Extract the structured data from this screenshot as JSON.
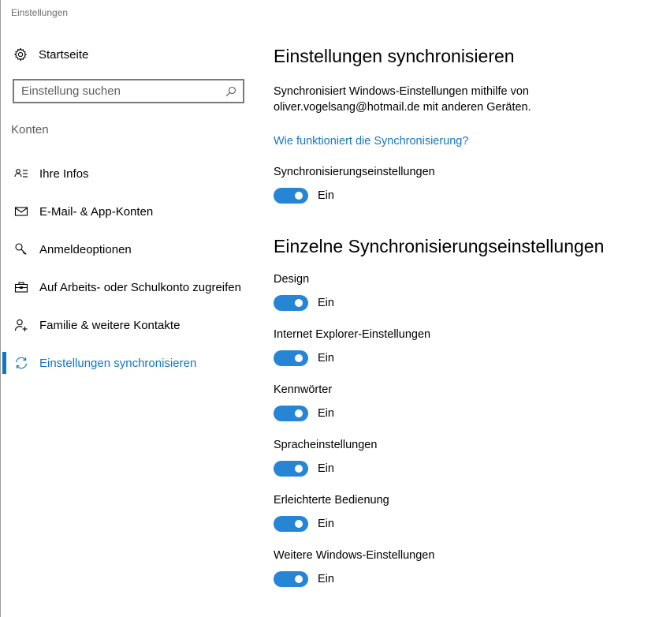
{
  "window": {
    "title": "Einstellungen"
  },
  "sidebar": {
    "home_label": "Startseite",
    "search": {
      "placeholder": "Einstellung suchen",
      "value": ""
    },
    "section_label": "Konten",
    "items": [
      {
        "label": "Ihre Infos",
        "icon": "contact-card-icon",
        "active": false
      },
      {
        "label": "E-Mail- & App-Konten",
        "icon": "mail-icon",
        "active": false
      },
      {
        "label": "Anmeldeoptionen",
        "icon": "key-icon",
        "active": false
      },
      {
        "label": "Auf Arbeits- oder Schulkonto zugreifen",
        "icon": "briefcase-icon",
        "active": false
      },
      {
        "label": "Familie & weitere Kontakte",
        "icon": "add-person-icon",
        "active": false
      },
      {
        "label": "Einstellungen synchronisieren",
        "icon": "sync-icon",
        "active": true
      }
    ]
  },
  "main": {
    "title": "Einstellungen synchronisieren",
    "description": "Synchronisiert Windows-Einstellungen mithilfe von oliver.vogelsang@hotmail.de mit anderen Geräten.",
    "help_link": "Wie funktioniert die Synchronisierung?",
    "master_setting": {
      "label": "Synchronisierungseinstellungen",
      "state": "Ein",
      "on": true
    },
    "section_title": "Einzelne Synchronisierungseinstellungen",
    "settings": [
      {
        "label": "Design",
        "state": "Ein",
        "on": true
      },
      {
        "label": "Internet Explorer-Einstellungen",
        "state": "Ein",
        "on": true
      },
      {
        "label": "Kennwörter",
        "state": "Ein",
        "on": true
      },
      {
        "label": "Spracheinstellungen",
        "state": "Ein",
        "on": true
      },
      {
        "label": "Erleichterte Bedienung",
        "state": "Ein",
        "on": true
      },
      {
        "label": "Weitere Windows-Einstellungen",
        "state": "Ein",
        "on": true
      }
    ]
  },
  "colors": {
    "accent": "#0f76c4",
    "toggle_on": "#2785d6",
    "link": "#1a76bf"
  }
}
